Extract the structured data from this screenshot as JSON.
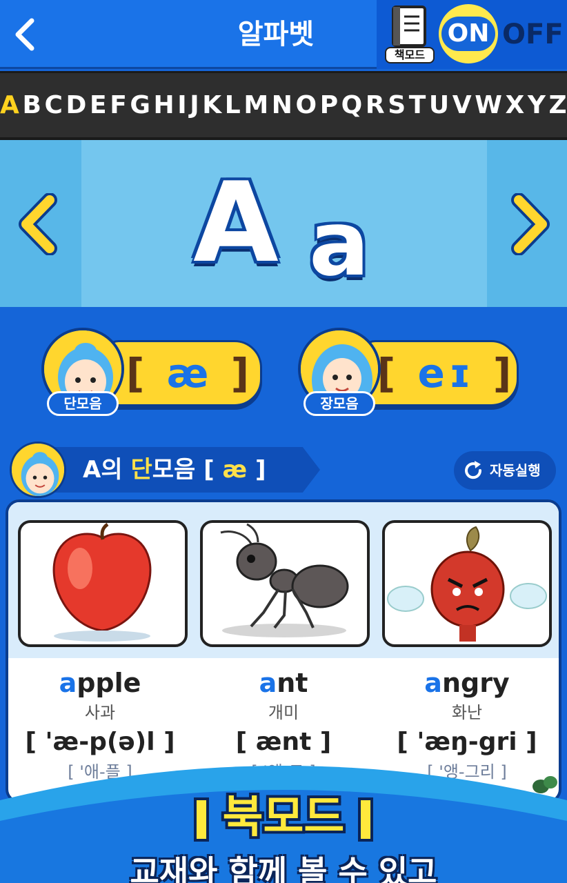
{
  "header": {
    "title": "알파벳",
    "book_mode_label": "책모드",
    "on_label": "ON",
    "off_label": "OFF"
  },
  "alphabet": [
    "A",
    "B",
    "C",
    "D",
    "E",
    "F",
    "G",
    "H",
    "I",
    "J",
    "K",
    "L",
    "M",
    "N",
    "O",
    "P",
    "Q",
    "R",
    "S",
    "T",
    "U",
    "V",
    "W",
    "X",
    "Y",
    "Z"
  ],
  "selected_letter": "A",
  "letter_display": {
    "upper": "A",
    "lower": "a"
  },
  "vowels": [
    {
      "tag": "단모음",
      "open": "[",
      "symbol": "æ",
      "close": "]"
    },
    {
      "tag": "장모음",
      "open": "[",
      "symbol": "eɪ",
      "close": "]"
    }
  ],
  "section": {
    "prefix": "A의 ",
    "highlight": "단",
    "suffix": "모음 [",
    "symbol": "æ",
    "end": "]",
    "autoplay_label": "자동실행"
  },
  "words": [
    {
      "first": "a",
      "rest": "pple",
      "meaning": "사과",
      "ipa_open": "[ 'æ",
      "ipa_rest": "-p(ə)l ]",
      "reading": "[ '애-플 ]",
      "image": "apple-image"
    },
    {
      "first": "a",
      "rest": "nt",
      "meaning": "개미",
      "ipa_open": "[ æ",
      "ipa_rest": "nt ]",
      "reading": "[ '앤-트 ]",
      "image": "ant-image"
    },
    {
      "first": "a",
      "rest": "ngry",
      "meaning": "화난",
      "ipa_open": "[ 'æ",
      "ipa_rest": "ŋ-gri ]",
      "reading": "[ '앵-그리 ]",
      "image": "angry-image"
    }
  ],
  "banner": {
    "title": "북모드",
    "subtitle": "교재와 함께 볼 수 있고"
  },
  "colors": {
    "primary": "#1a73e8",
    "accent_yellow": "#ffd62e",
    "dark_navy": "#0b3c8e",
    "alphabet_bar": "#2e2e2e"
  }
}
